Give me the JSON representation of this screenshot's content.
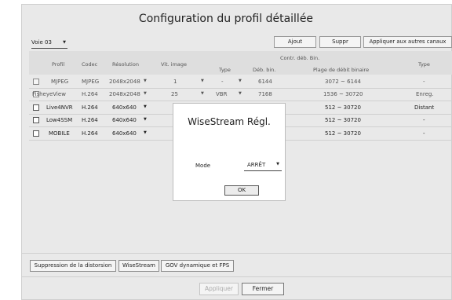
{
  "title": "Configuration du profil détaillée",
  "channel_select": {
    "value": "Voie 03"
  },
  "top_buttons": {
    "add": "Ajout",
    "delete": "Suppr",
    "apply_all": "Appliquer aux autres canaux"
  },
  "table": {
    "headers": {
      "profile": "Profil",
      "codec": "Codec",
      "resolution": "Résolution",
      "frame_rate": "Vit. image",
      "bitrate_control": "Contr. déb. Bin.",
      "type": "Type",
      "bitrate": "Déb. bin.",
      "bitrate_range": "Plage de débit binaire",
      "profile_type": "Type"
    },
    "rows": [
      {
        "profile": "MJPEG",
        "codec": "MJPEG",
        "resolution": "2048x2048",
        "frame_rate": "1",
        "type": "-",
        "bitrate": "6144",
        "range": "3072 ~ 6144",
        "profile_type": "-"
      },
      {
        "profile": "FisheyeView",
        "codec": "H.264",
        "resolution": "2048x2048",
        "frame_rate": "25",
        "type": "VBR",
        "bitrate": "7168",
        "range": "1536 ~ 30720",
        "profile_type": "Enreg."
      },
      {
        "profile": "Live4NVR",
        "codec": "H.264",
        "resolution": "640x640",
        "frame_rate": "",
        "type": "",
        "bitrate": "",
        "range": "512 ~ 30720",
        "profile_type": "Distant"
      },
      {
        "profile": "Low4SSM",
        "codec": "H.264",
        "resolution": "640x640",
        "frame_rate": "",
        "type": "",
        "bitrate": "",
        "range": "512 ~ 30720",
        "profile_type": "-"
      },
      {
        "profile": "MOBILE",
        "codec": "H.264",
        "resolution": "640x640",
        "frame_rate": "",
        "type": "",
        "bitrate": "",
        "range": "512 ~ 30720",
        "profile_type": "-"
      }
    ]
  },
  "feature_buttons": {
    "dewarp": "Suppression de la distorsion",
    "wisestream": "WiseStream",
    "dynamic_gov": "GOV dynamique et FPS"
  },
  "bottom_buttons": {
    "apply": "Appliquer",
    "close": "Fermer"
  },
  "dialog": {
    "title": "WiseStream Régl.",
    "mode_label": "Mode",
    "mode_value": "ARRÊT",
    "ok": "OK"
  },
  "icons": {
    "dropdown": "chevron-down-icon",
    "checkbox": "checkbox-icon"
  },
  "colors": {
    "frame_bg": "#e9e9e9",
    "header_bg": "#dedede",
    "dialog_bg": "#ffffff"
  }
}
